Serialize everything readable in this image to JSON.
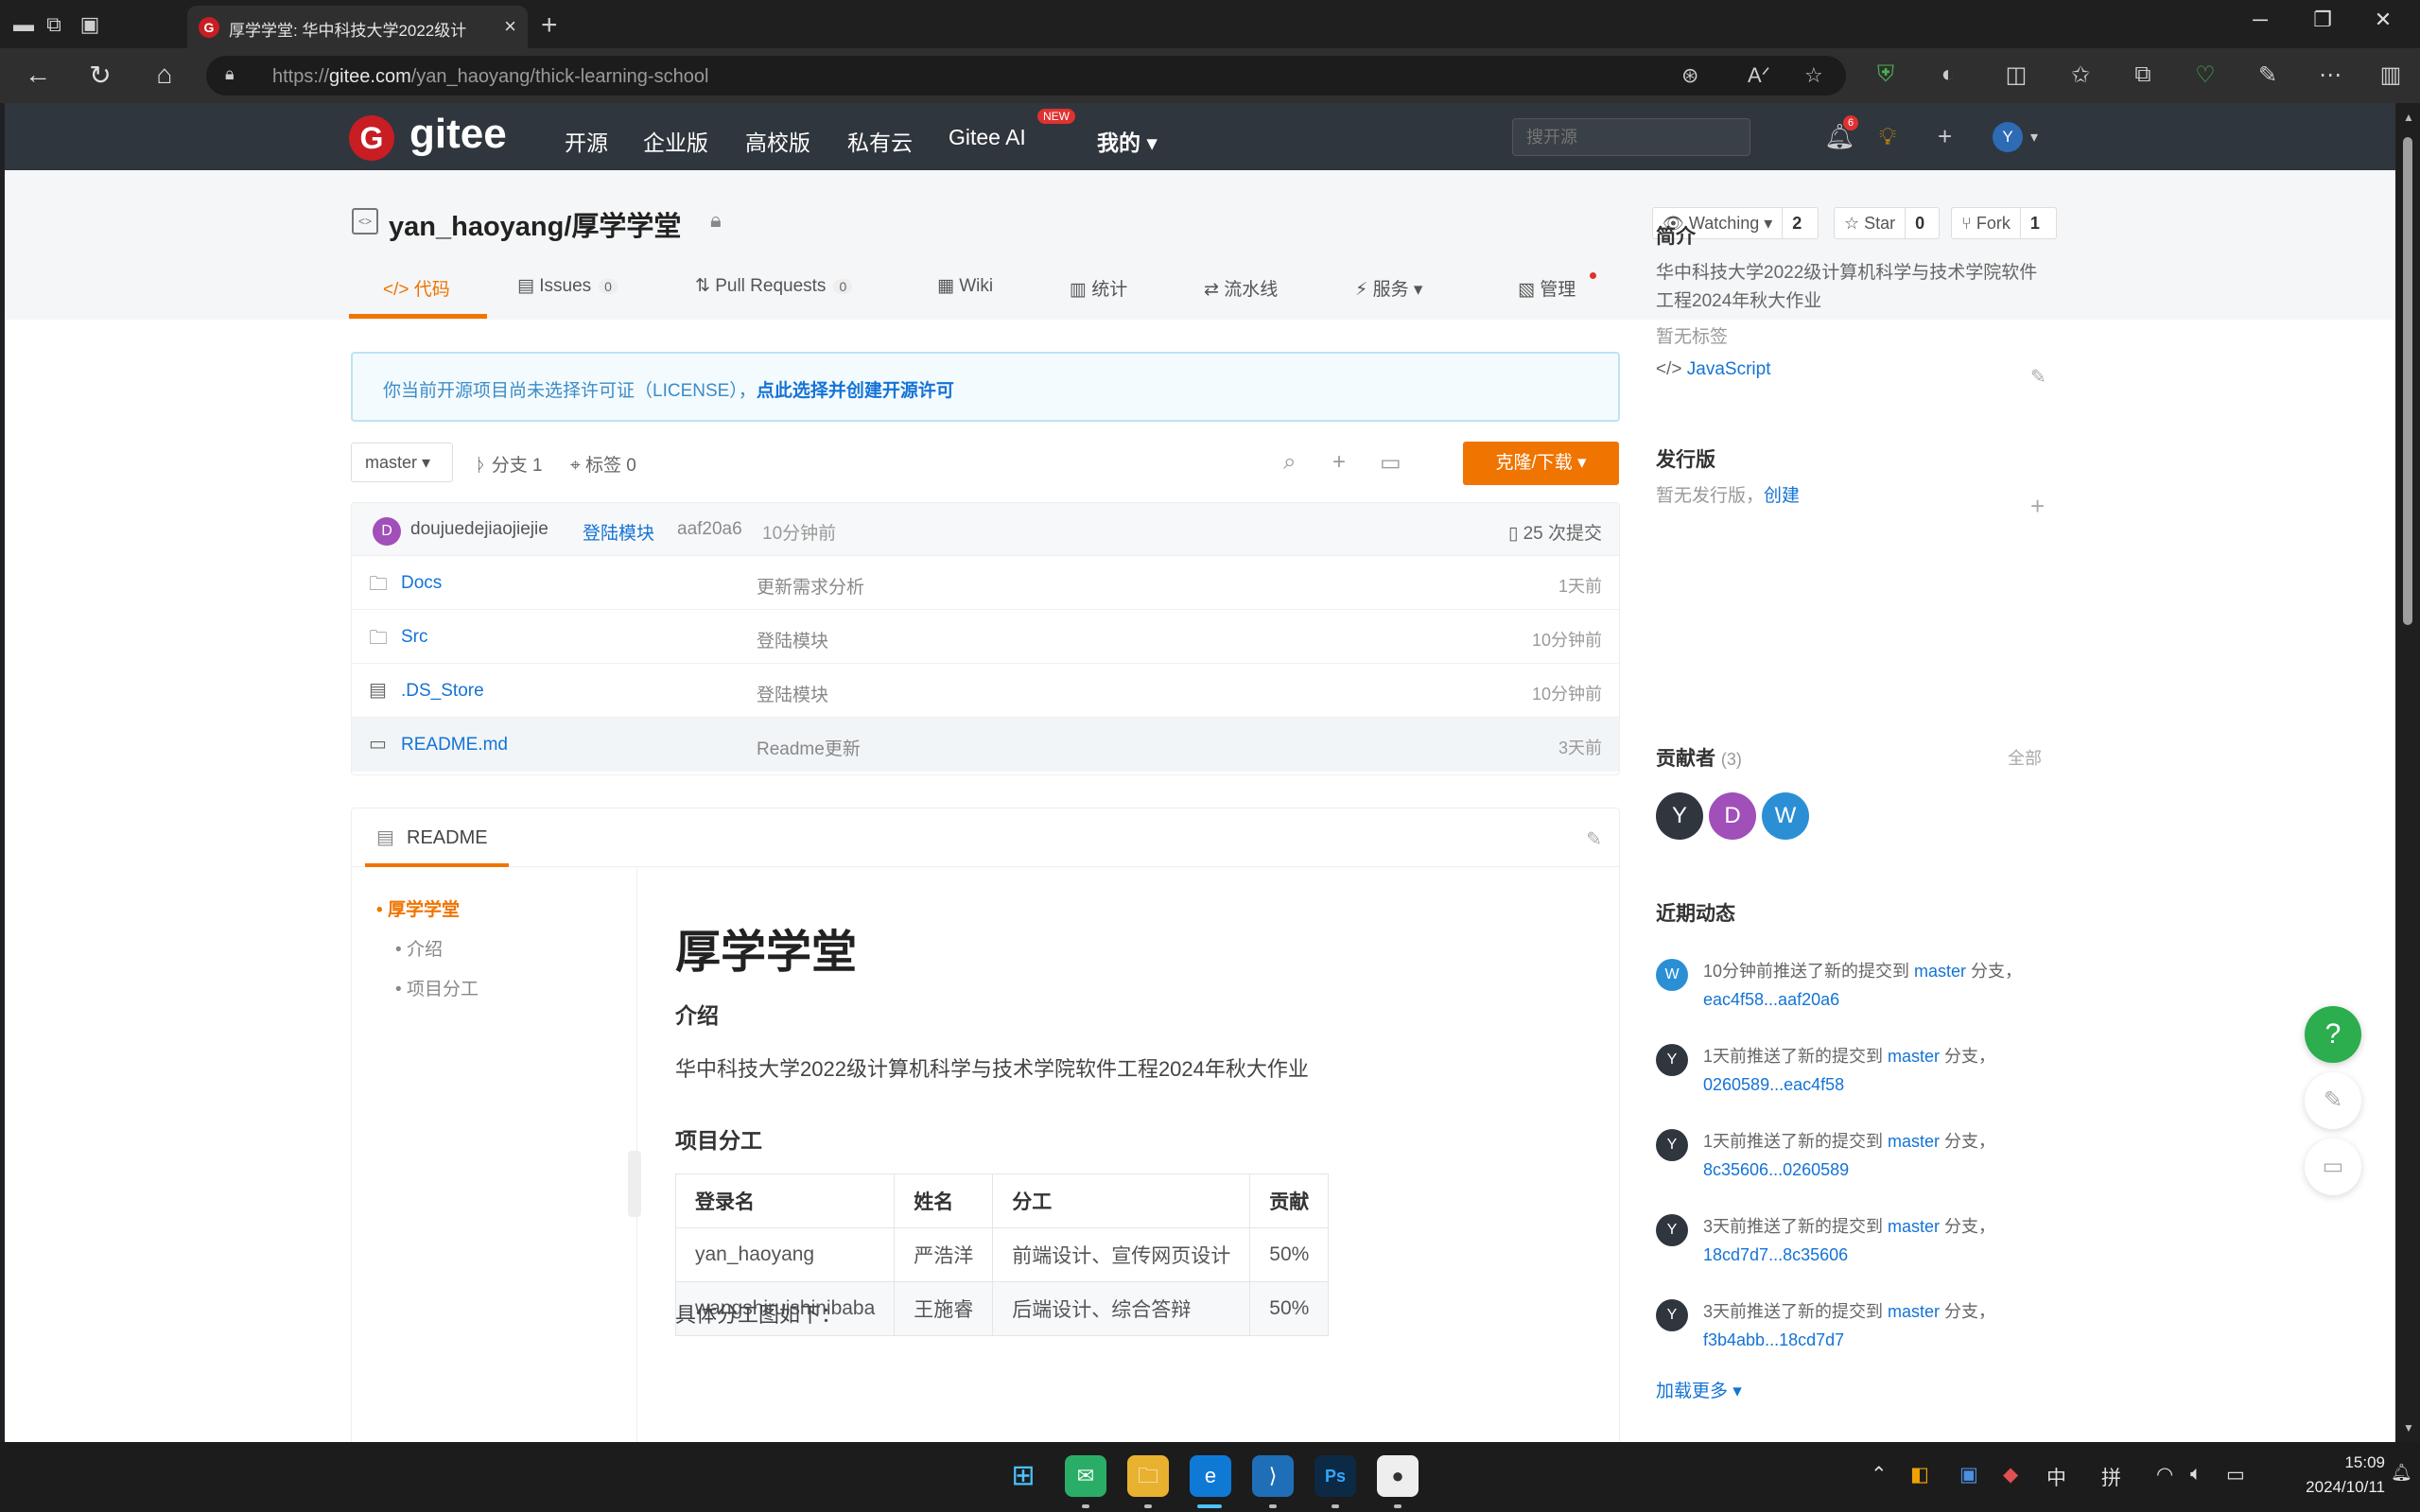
{
  "browser": {
    "tab_title": "厚学学堂: 华中科技大学2022级计",
    "url_prefix": "https://",
    "url_domain": "gitee.com",
    "url_path": "/yan_haoyang/thick-learning-school"
  },
  "header": {
    "logo_mark": "G",
    "logo_text": "gitee",
    "nav": [
      "开源",
      "企业版",
      "高校版",
      "私有云",
      "Gitee AI",
      "我的"
    ],
    "new_badge": "NEW",
    "search_placeholder": "搜开源",
    "notification_count": "6",
    "avatar_letter": "Y"
  },
  "repo": {
    "name": "yan_haoyang/厚学学堂",
    "watch_label": "Watching",
    "watch_count": "2",
    "star_label": "Star",
    "star_count": "0",
    "fork_label": "Fork",
    "fork_count": "1",
    "tabs": [
      {
        "label": "代码",
        "count": ""
      },
      {
        "label": "Issues",
        "count": "0"
      },
      {
        "label": "Pull Requests",
        "count": "0"
      },
      {
        "label": "Wiki",
        "count": ""
      },
      {
        "label": "统计",
        "count": ""
      },
      {
        "label": "流水线",
        "count": ""
      },
      {
        "label": "服务",
        "count": ""
      },
      {
        "label": "管理",
        "count": ""
      }
    ]
  },
  "license_notice": {
    "text": "你当前开源项目尚未选择许可证（LICENSE），",
    "link": "点此选择并创建开源许可"
  },
  "branch": {
    "current": "master",
    "branches": "分支 1",
    "tags": "标签 0",
    "clone_button": "克隆/下载"
  },
  "commit": {
    "author_initial": "D",
    "author": "doujuedejiaojiejie",
    "message": "登陆模块",
    "hash": "aaf20a6",
    "time": "10分钟前",
    "count": "25 次提交"
  },
  "files": [
    {
      "icon": "folder",
      "name": "Docs",
      "message": "更新需求分析",
      "time": "1天前"
    },
    {
      "icon": "folder",
      "name": "Src",
      "message": "登陆模块",
      "time": "10分钟前"
    },
    {
      "icon": "file",
      "name": ".DS_Store",
      "message": "登陆模块",
      "time": "10分钟前"
    },
    {
      "icon": "markdown",
      "name": "README.md",
      "message": "Readme更新",
      "time": "3天前"
    }
  ],
  "readme": {
    "title": "README",
    "toc": [
      "厚学学堂",
      "介绍",
      "项目分工"
    ],
    "h1": "厚学学堂",
    "h2_intro": "介绍",
    "intro_text": "华中科技大学2022级计算机科学与技术学院软件工程2024年秋大作业",
    "h2_division": "项目分工",
    "table_headers": [
      "登录名",
      "姓名",
      "分工",
      "贡献"
    ],
    "table_rows": [
      [
        "yan_haoyang",
        "严浩洋",
        "前端设计、宣传网页设计",
        "50%"
      ],
      [
        "wangshiruishinibaba",
        "王施睿",
        "后端设计、综合答辩",
        "50%"
      ]
    ],
    "after_table": "具体分工图如下："
  },
  "sidebar": {
    "intro_title": "简介",
    "intro_text": "华中科技大学2022级计算机科学与技术学院软件工程2024年秋大作业",
    "no_tags": "暂无标签",
    "language": "JavaScript",
    "releases_title": "发行版",
    "no_releases": "暂无发行版，",
    "create_link": "创建",
    "contributors_title": "贡献者",
    "contributors_count": "(3)",
    "contributors_all": "全部",
    "contributors": [
      "Y",
      "D",
      "W"
    ],
    "activity_title": "近期动态",
    "activities": [
      {
        "initial": "W",
        "text": "10分钟前推送了新的提交到 ",
        "branch": "master",
        "suffix": " 分支，",
        "range": "eac4f58...aaf20a6"
      },
      {
        "initial": "Y",
        "text": "1天前推送了新的提交到 ",
        "branch": "master",
        "suffix": " 分支，",
        "range": "0260589...eac4f58"
      },
      {
        "initial": "Y",
        "text": "1天前推送了新的提交到 ",
        "branch": "master",
        "suffix": " 分支，",
        "range": "8c35606...0260589"
      },
      {
        "initial": "Y",
        "text": "3天前推送了新的提交到 ",
        "branch": "master",
        "suffix": " 分支，",
        "range": "18cd7d7...8c35606"
      },
      {
        "initial": "Y",
        "text": "3天前推送了新的提交到 ",
        "branch": "master",
        "suffix": " 分支，",
        "range": "f3b4abb...18cd7d7"
      }
    ],
    "load_more": "加载更多"
  },
  "taskbar": {
    "time": "15:09",
    "date": "2024/10/11",
    "ime_1": "中",
    "ime_2": "拼"
  },
  "colors": {
    "accent": "#f07400",
    "gitee_red": "#c71d23",
    "link": "#1473d6",
    "header_bg": "#30363d",
    "help_green": "#2cad4e"
  }
}
